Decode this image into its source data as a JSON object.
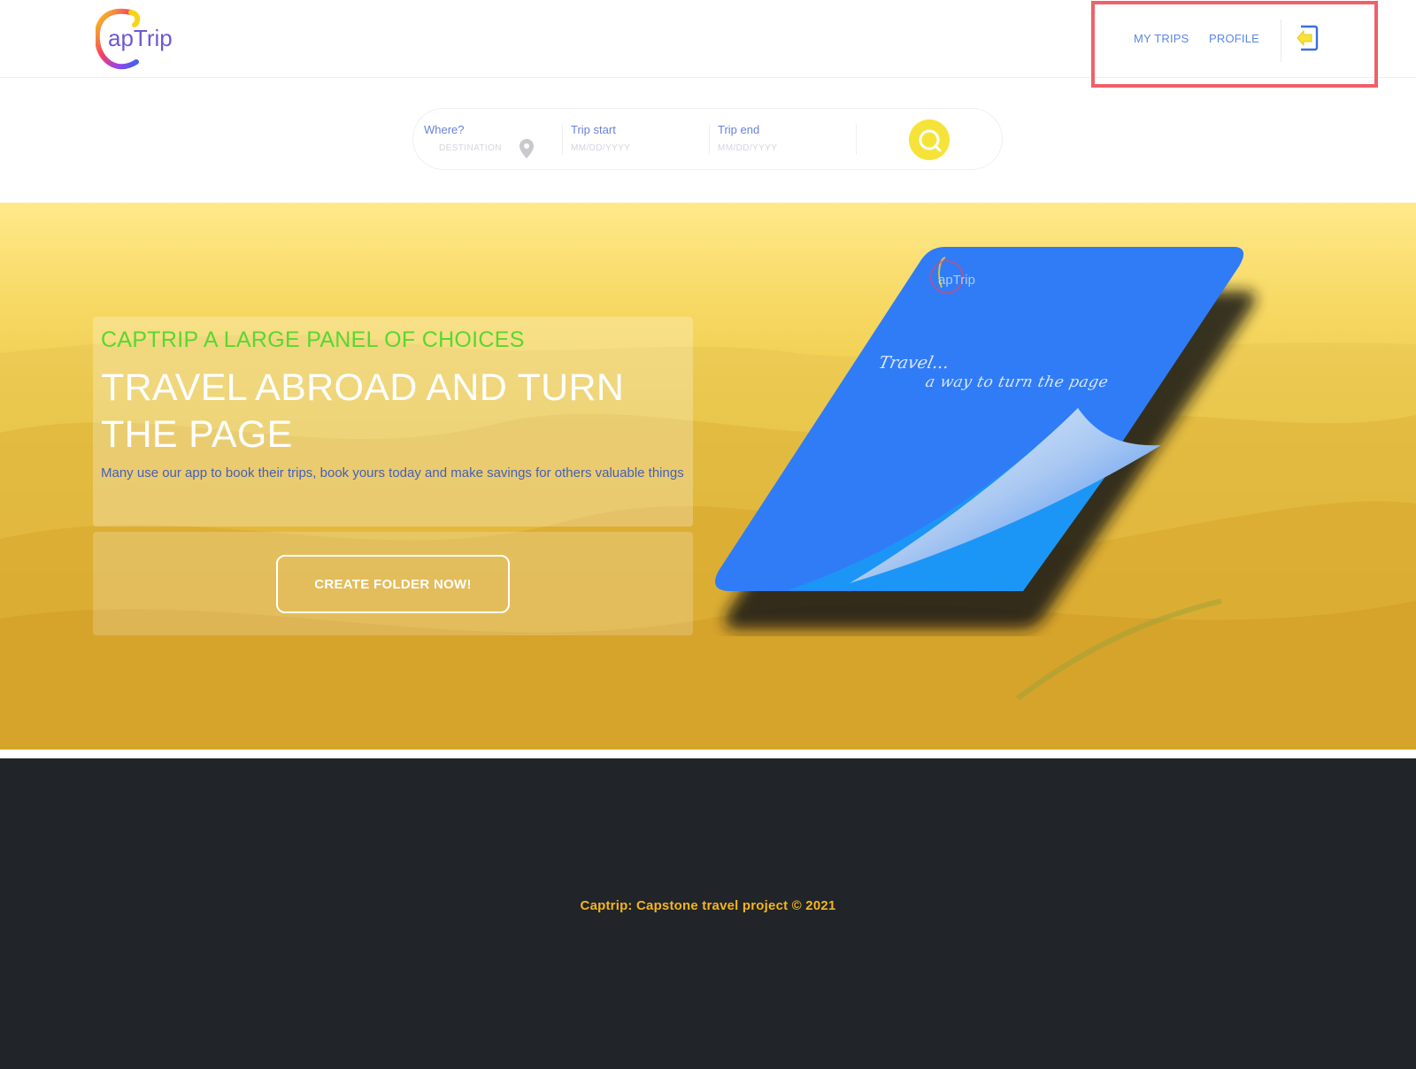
{
  "header": {
    "logo_text": "apTrip",
    "nav": {
      "my_trips": "MY TRIPS",
      "profile": "PROFILE"
    },
    "logout_icon": "logout-arrow-icon"
  },
  "search": {
    "where_label": "Where?",
    "where_placeholder": "DESTINATION",
    "start_label": "Trip start",
    "start_placeholder": "MM/DD/YYYY",
    "end_label": "Trip end",
    "end_placeholder": "MM/DD/YYYY",
    "location_icon": "map-pin-icon",
    "search_icon": "search-icon"
  },
  "hero": {
    "subtitle": "CAPTRIP A LARGE PANEL OF CHOICES",
    "title": "TRAVEL ABROAD AND TURN THE PAGE",
    "description": "Many use our app to book their trips, book yours today and make savings for others valuable things",
    "cta_label": "CREATE FOLDER NOW!",
    "book": {
      "logo_text": "apTrip",
      "line1": "Travel...",
      "line2": "a way to turn the page"
    }
  },
  "footer": {
    "text": "Captrip: Capstone travel project © 2021"
  },
  "colors": {
    "accent_yellow": "#f6e33a",
    "nav_blue": "#5a86e8",
    "subtitle_green": "#57d832",
    "book_blue": "#2f7cf6",
    "footer_bg": "#212429",
    "footer_text": "#f2b51d",
    "highlight_red": "#f0606a"
  }
}
